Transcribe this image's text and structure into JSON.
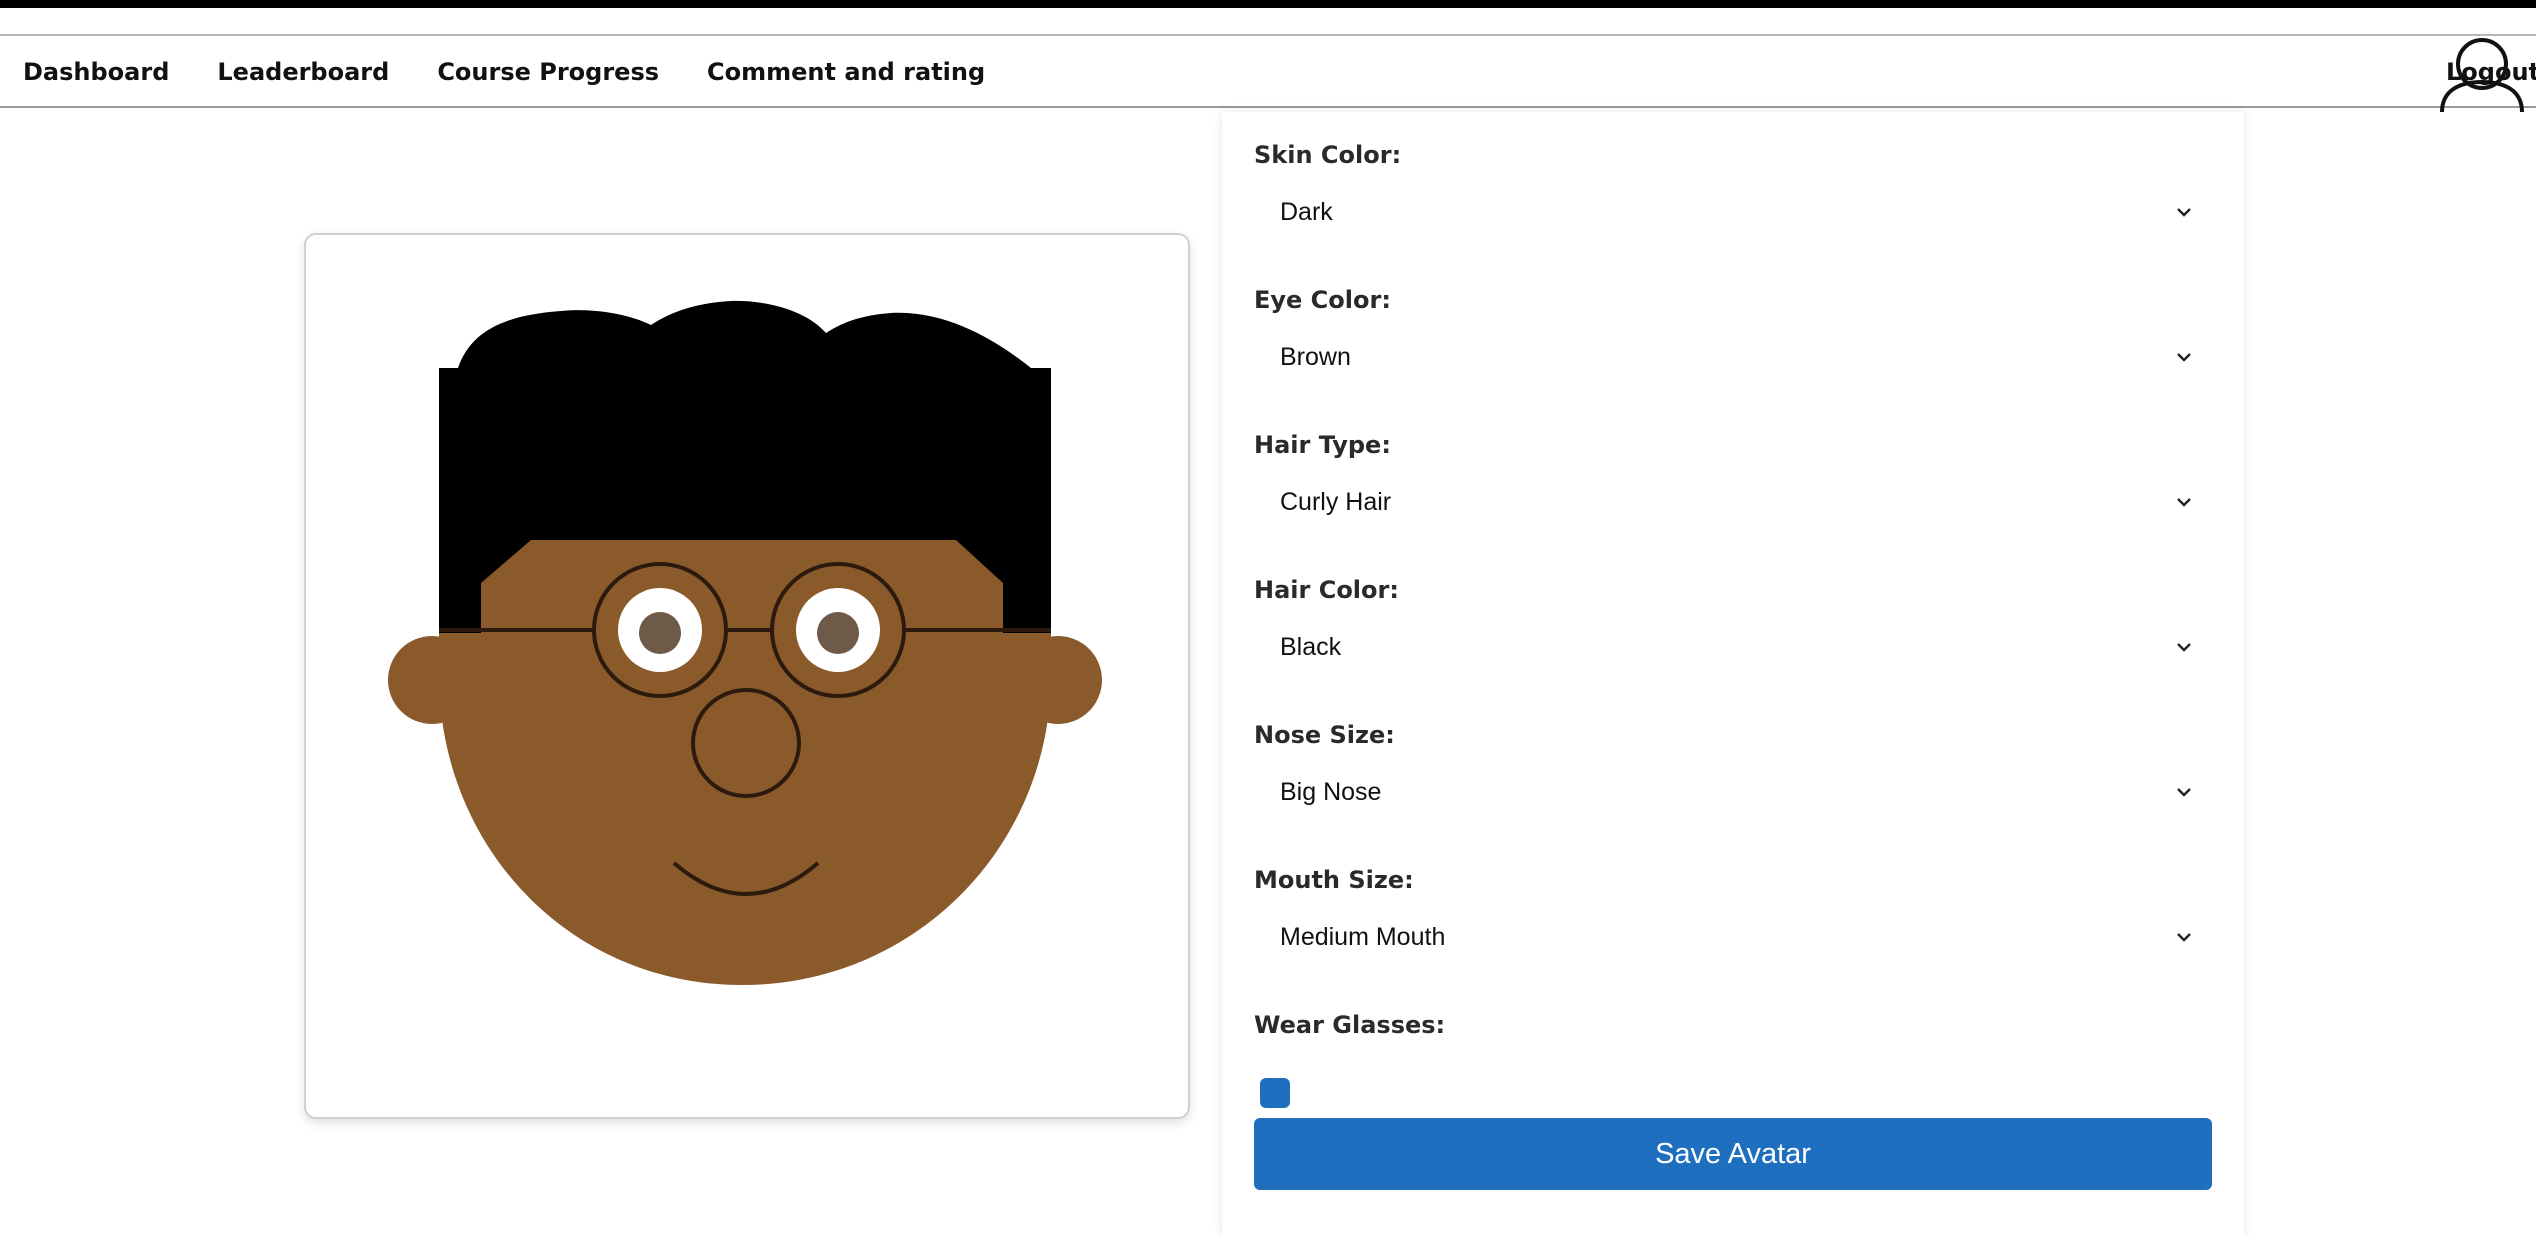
{
  "nav": {
    "links": [
      "Dashboard",
      "Leaderboard",
      "Course Progress",
      "Comment and rating"
    ],
    "logout": "Logout",
    "user_icon": "user-icon"
  },
  "avatar": {
    "skin_hex": "#8b5a2b",
    "hair_hex": "#000000",
    "eye_iris_hex": "#6e5a48",
    "glasses": true
  },
  "form": {
    "fields": [
      {
        "label": "Skin Color:",
        "value": "Dark"
      },
      {
        "label": "Eye Color:",
        "value": "Brown"
      },
      {
        "label": "Hair Type:",
        "value": "Curly Hair"
      },
      {
        "label": "Hair Color:",
        "value": "Black"
      },
      {
        "label": "Nose Size:",
        "value": "Big Nose"
      },
      {
        "label": "Mouth Size:",
        "value": "Medium Mouth"
      }
    ],
    "glasses_label": "Wear Glasses:",
    "glasses_checked": true,
    "save_label": "Save Avatar"
  },
  "colors": {
    "accent": "#1f6fc1",
    "top_bar": "#000000"
  }
}
